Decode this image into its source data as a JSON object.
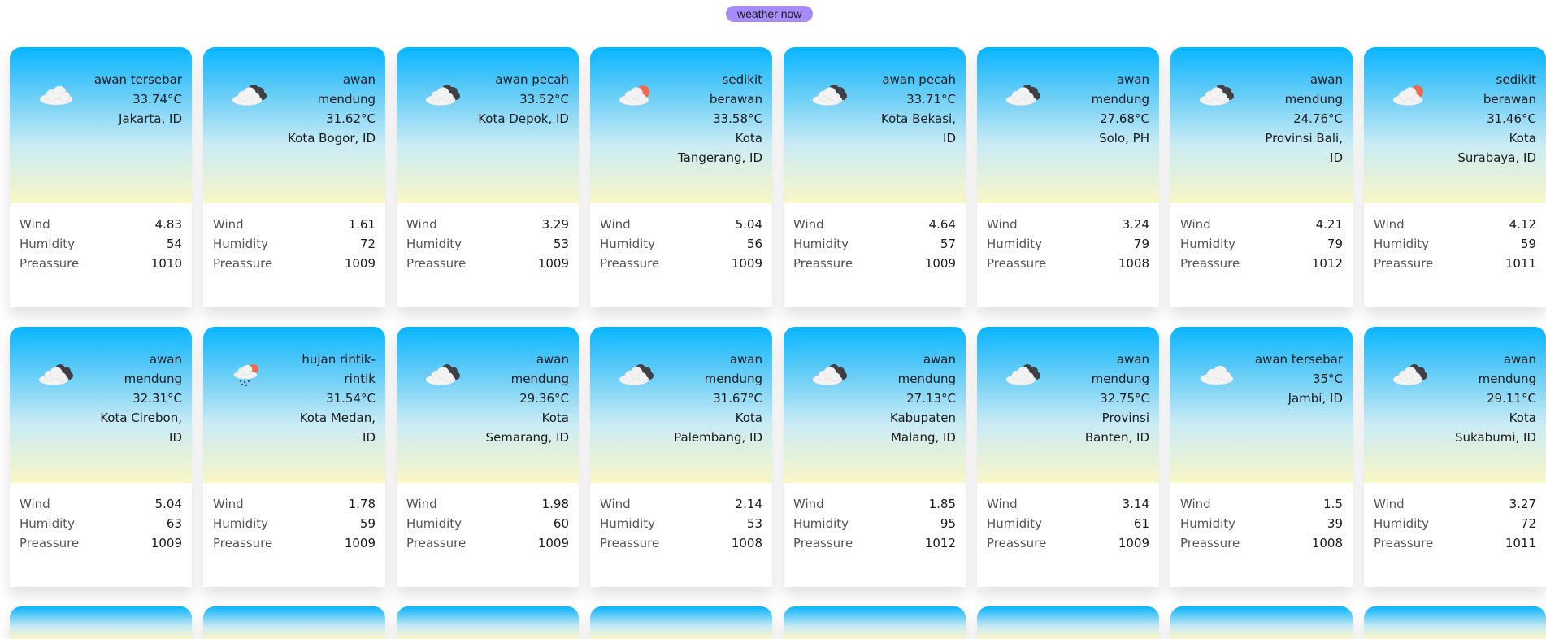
{
  "header": {
    "title": "weather now"
  },
  "labels": {
    "wind": "Wind",
    "humidity": "Humidity",
    "pressure": "Preassure"
  },
  "cards": [
    {
      "icon": "scattered-clouds-icon",
      "desc": "awan tersebar",
      "temp": "33.74°C",
      "city": "Jakarta, ID",
      "wind": "4.83",
      "humidity": "54",
      "pressure": "1010"
    },
    {
      "icon": "broken-clouds-icon",
      "desc": "awan mendung",
      "temp": "31.62°C",
      "city": "Kota Bogor, ID",
      "wind": "1.61",
      "humidity": "72",
      "pressure": "1009"
    },
    {
      "icon": "broken-clouds-icon",
      "desc": "awan pecah",
      "temp": "33.52°C",
      "city": "Kota Depok, ID",
      "wind": "3.29",
      "humidity": "53",
      "pressure": "1009"
    },
    {
      "icon": "few-clouds-icon",
      "desc": "sedikit berawan",
      "temp": "33.58°C",
      "city": "Kota Tangerang, ID",
      "wind": "5.04",
      "humidity": "56",
      "pressure": "1009"
    },
    {
      "icon": "broken-clouds-icon",
      "desc": "awan pecah",
      "temp": "33.71°C",
      "city": "Kota Bekasi, ID",
      "wind": "4.64",
      "humidity": "57",
      "pressure": "1009"
    },
    {
      "icon": "broken-clouds-icon",
      "desc": "awan mendung",
      "temp": "27.68°C",
      "city": "Solo, PH",
      "wind": "3.24",
      "humidity": "79",
      "pressure": "1008"
    },
    {
      "icon": "broken-clouds-icon",
      "desc": "awan mendung",
      "temp": "24.76°C",
      "city": "Provinsi Bali, ID",
      "wind": "4.21",
      "humidity": "79",
      "pressure": "1012"
    },
    {
      "icon": "few-clouds-icon",
      "desc": "sedikit berawan",
      "temp": "31.46°C",
      "city": "Kota Surabaya, ID",
      "wind": "4.12",
      "humidity": "59",
      "pressure": "1011"
    },
    {
      "icon": "broken-clouds-icon",
      "desc": "awan mendung",
      "temp": "32.31°C",
      "city": "Kota Cirebon, ID",
      "wind": "5.04",
      "humidity": "63",
      "pressure": "1009"
    },
    {
      "icon": "light-rain-icon",
      "desc": "hujan rintik-rintik",
      "temp": "31.54°C",
      "city": "Kota Medan, ID",
      "wind": "1.78",
      "humidity": "59",
      "pressure": "1009"
    },
    {
      "icon": "broken-clouds-icon",
      "desc": "awan mendung",
      "temp": "29.36°C",
      "city": "Kota Semarang, ID",
      "wind": "1.98",
      "humidity": "60",
      "pressure": "1009"
    },
    {
      "icon": "broken-clouds-icon",
      "desc": "awan mendung",
      "temp": "31.67°C",
      "city": "Kota Palembang, ID",
      "wind": "2.14",
      "humidity": "53",
      "pressure": "1008"
    },
    {
      "icon": "broken-clouds-icon",
      "desc": "awan mendung",
      "temp": "27.13°C",
      "city": "Kabupaten Malang, ID",
      "wind": "1.85",
      "humidity": "95",
      "pressure": "1012"
    },
    {
      "icon": "broken-clouds-icon",
      "desc": "awan mendung",
      "temp": "32.75°C",
      "city": "Provinsi Banten, ID",
      "wind": "3.14",
      "humidity": "61",
      "pressure": "1009"
    },
    {
      "icon": "scattered-clouds-icon",
      "desc": "awan tersebar",
      "temp": "35°C",
      "city": "Jambi, ID",
      "wind": "1.5",
      "humidity": "39",
      "pressure": "1008"
    },
    {
      "icon": "broken-clouds-icon",
      "desc": "awan mendung",
      "temp": "29.11°C",
      "city": "Kota Sukabumi, ID",
      "wind": "3.27",
      "humidity": "72",
      "pressure": "1011"
    }
  ],
  "partial_row_count": 8
}
